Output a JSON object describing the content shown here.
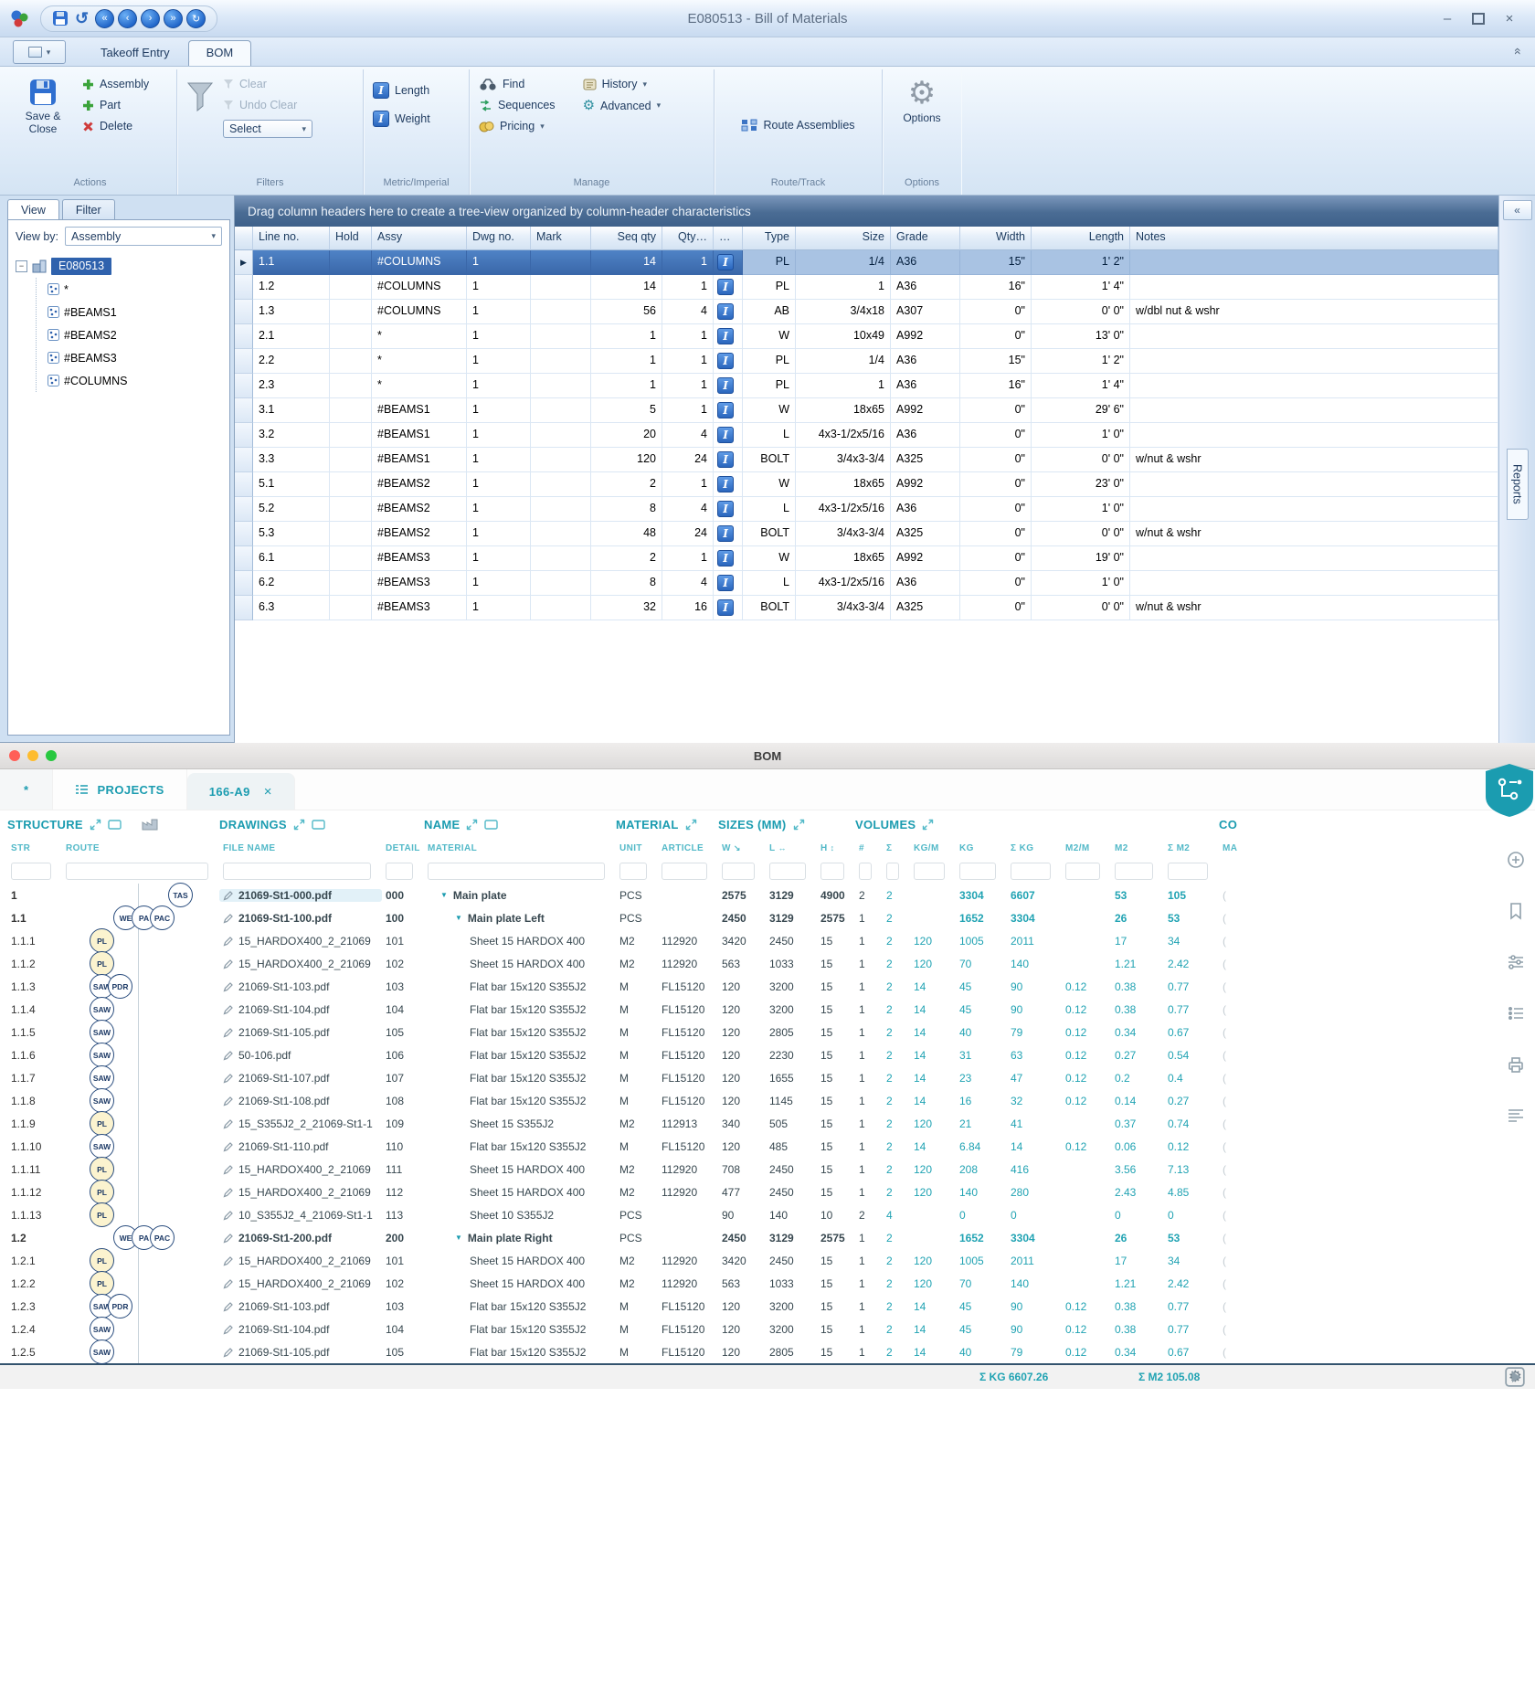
{
  "icons": {
    "dropdown": "▾",
    "collapse": "«",
    "close": "×",
    "minimize": "–",
    "undo": "↺",
    "gear": "⚙",
    "qat": [
      "«",
      "‹",
      "›",
      "»",
      "↻"
    ],
    "row_arrow": "▶",
    "tree_collapse": "−",
    "node_caret": "▼",
    "w_arrow": "↘",
    "l_arrow": "↔",
    "h_arrow": "↕"
  },
  "colors": {
    "accent_teal": "#1B9CB0",
    "selection_blue": "#3F71B8",
    "badge_yellow": "#FBF3CF",
    "traffic_red": "#FF5F57",
    "traffic_yellow": "#FEBC2E",
    "traffic_green": "#28C840"
  },
  "window": {
    "title": "E080513 - Bill of Materials",
    "app_tabs": {
      "takeoff": "Takeoff Entry",
      "bom": "BOM"
    },
    "ribbon": {
      "actions": {
        "label": "Actions",
        "save_close": "Save & Close",
        "assembly": "Assembly",
        "part": "Part",
        "delete": "Delete"
      },
      "filters": {
        "label": "Filters",
        "clear": "Clear",
        "undo_clear": "Undo Clear",
        "select": "Select"
      },
      "metric": {
        "label": "Metric/Imperial",
        "length": "Length",
        "weight": "Weight"
      },
      "manage": {
        "label": "Manage",
        "find": "Find",
        "sequences": "Sequences",
        "pricing": "Pricing",
        "history": "History",
        "advanced": "Advanced"
      },
      "route": {
        "label": "Route/Track",
        "route_assemblies": "Route Assemblies"
      },
      "options": {
        "label": "Options",
        "options": "Options"
      }
    },
    "left_panel": {
      "tabs": {
        "view": "View",
        "filter": "Filter"
      },
      "view_by_label": "View by:",
      "view_by_value": "Assembly",
      "tree": {
        "root": "E080513",
        "items": [
          "*",
          "#BEAMS1",
          "#BEAMS2",
          "#BEAMS3",
          "#COLUMNS"
        ]
      }
    },
    "grid": {
      "group_hint": "Drag column headers here to create a tree-view organized by column-header characteristics",
      "columns": [
        "Line no.",
        "Hold",
        "Assy",
        "Dwg no.",
        "Mark",
        "Seq qty",
        "Qty…",
        "…",
        "Type",
        "Size",
        "Grade",
        "Width",
        "Length",
        "Notes"
      ],
      "selected_index": 0,
      "rows": [
        [
          "1.1",
          "",
          "#COLUMNS",
          "1",
          "",
          "14",
          "1",
          "PL",
          "1/4",
          "A36",
          "15\"",
          "1' 2\"",
          ""
        ],
        [
          "1.2",
          "",
          "#COLUMNS",
          "1",
          "",
          "14",
          "1",
          "PL",
          "1",
          "A36",
          "16\"",
          "1' 4\"",
          ""
        ],
        [
          "1.3",
          "",
          "#COLUMNS",
          "1",
          "",
          "56",
          "4",
          "AB",
          "3/4x18",
          "A307",
          "0\"",
          "0' 0\"",
          "w/dbl nut & wshr"
        ],
        [
          "2.1",
          "",
          "*",
          "1",
          "",
          "1",
          "1",
          "W",
          "10x49",
          "A992",
          "0\"",
          "13' 0\"",
          ""
        ],
        [
          "2.2",
          "",
          "*",
          "1",
          "",
          "1",
          "1",
          "PL",
          "1/4",
          "A36",
          "15\"",
          "1' 2\"",
          ""
        ],
        [
          "2.3",
          "",
          "*",
          "1",
          "",
          "1",
          "1",
          "PL",
          "1",
          "A36",
          "16\"",
          "1' 4\"",
          ""
        ],
        [
          "3.1",
          "",
          "#BEAMS1",
          "1",
          "",
          "5",
          "1",
          "W",
          "18x65",
          "A992",
          "0\"",
          "29' 6\"",
          ""
        ],
        [
          "3.2",
          "",
          "#BEAMS1",
          "1",
          "",
          "20",
          "4",
          "L",
          "4x3-1/2x5/16",
          "A36",
          "0\"",
          "1' 0\"",
          ""
        ],
        [
          "3.3",
          "",
          "#BEAMS1",
          "1",
          "",
          "120",
          "24",
          "BOLT",
          "3/4x3-3/4",
          "A325",
          "0\"",
          "0' 0\"",
          "w/nut & wshr"
        ],
        [
          "5.1",
          "",
          "#BEAMS2",
          "1",
          "",
          "2",
          "1",
          "W",
          "18x65",
          "A992",
          "0\"",
          "23' 0\"",
          ""
        ],
        [
          "5.2",
          "",
          "#BEAMS2",
          "1",
          "",
          "8",
          "4",
          "L",
          "4x3-1/2x5/16",
          "A36",
          "0\"",
          "1' 0\"",
          ""
        ],
        [
          "5.3",
          "",
          "#BEAMS2",
          "1",
          "",
          "48",
          "24",
          "BOLT",
          "3/4x3-3/4",
          "A325",
          "0\"",
          "0' 0\"",
          "w/nut & wshr"
        ],
        [
          "6.1",
          "",
          "#BEAMS3",
          "1",
          "",
          "2",
          "1",
          "W",
          "18x65",
          "A992",
          "0\"",
          "19' 0\"",
          ""
        ],
        [
          "6.2",
          "",
          "#BEAMS3",
          "1",
          "",
          "8",
          "4",
          "L",
          "4x3-1/2x5/16",
          "A36",
          "0\"",
          "1' 0\"",
          ""
        ],
        [
          "6.3",
          "",
          "#BEAMS3",
          "1",
          "",
          "32",
          "16",
          "BOLT",
          "3/4x3-3/4",
          "A325",
          "0\"",
          "0' 0\"",
          "w/nut & wshr"
        ]
      ]
    },
    "reports_tab": "Reports"
  },
  "mac": {
    "title": "BOM",
    "tabs": {
      "star": "*",
      "projects": "PROJECTS",
      "active": "166-A9"
    },
    "table": {
      "groups": [
        "STRUCTURE",
        "DRAWINGS",
        "NAME",
        "MATERIAL",
        "SIZES (MM)",
        "VOLUMES",
        "CO"
      ],
      "subheaders": [
        "STR",
        "ROUTE",
        "FILE NAME",
        "DETAIL",
        "MATERIAL",
        "UNIT",
        "ARTICLE",
        "W",
        "L",
        "H",
        "#",
        "Σ",
        "KG/M",
        "KG",
        "Σ KG",
        "M2/M",
        "M2",
        "Σ M2",
        "MA"
      ],
      "row_fields": [
        "str",
        "badges",
        "badge_pos",
        "file",
        "detail",
        "indent",
        "name",
        "unit",
        "article",
        "w",
        "l",
        "h",
        "n",
        "sum",
        "kgm",
        "kg",
        "skg",
        "m2m",
        "m2",
        "sm2",
        "parent"
      ],
      "rows": [
        [
          "1",
          [
            "TAS"
          ],
          "r",
          "21069-St1-000.pdf",
          "000",
          0,
          "Main plate",
          "PCS",
          "",
          "2575",
          "3129",
          "4900",
          "2",
          "2",
          "",
          "3304",
          "6607",
          "",
          "53",
          "105",
          true
        ],
        [
          "1.1",
          [
            "WE",
            "PA",
            "PAC"
          ],
          "m",
          "21069-St1-100.pdf",
          "100",
          1,
          "Main plate Left",
          "PCS",
          "",
          "2450",
          "3129",
          "2575",
          "1",
          "2",
          "",
          "1652",
          "3304",
          "",
          "26",
          "53",
          true
        ],
        [
          "1.1.1",
          [
            "PL"
          ],
          "l",
          "15_HARDOX400_2_21069",
          "101",
          2,
          "Sheet 15 HARDOX 400",
          "M2",
          "112920",
          "3420",
          "2450",
          "15",
          "1",
          "2",
          "120",
          "1005",
          "2011",
          "",
          "17",
          "34",
          false
        ],
        [
          "1.1.2",
          [
            "PL"
          ],
          "l",
          "15_HARDOX400_2_21069",
          "102",
          2,
          "Sheet 15 HARDOX 400",
          "M2",
          "112920",
          "563",
          "1033",
          "15",
          "1",
          "2",
          "120",
          "70",
          "140",
          "",
          "1.21",
          "2.42",
          false
        ],
        [
          "1.1.3",
          [
            "SAW",
            "PDR"
          ],
          "l",
          "21069-St1-103.pdf",
          "103",
          2,
          "Flat bar 15x120 S355J2",
          "M",
          "FL15120",
          "120",
          "3200",
          "15",
          "1",
          "2",
          "14",
          "45",
          "90",
          "0.12",
          "0.38",
          "0.77",
          false
        ],
        [
          "1.1.4",
          [
            "SAW"
          ],
          "l",
          "21069-St1-104.pdf",
          "104",
          2,
          "Flat bar 15x120 S355J2",
          "M",
          "FL15120",
          "120",
          "3200",
          "15",
          "1",
          "2",
          "14",
          "45",
          "90",
          "0.12",
          "0.38",
          "0.77",
          false
        ],
        [
          "1.1.5",
          [
            "SAW"
          ],
          "l",
          "21069-St1-105.pdf",
          "105",
          2,
          "Flat bar 15x120 S355J2",
          "M",
          "FL15120",
          "120",
          "2805",
          "15",
          "1",
          "2",
          "14",
          "40",
          "79",
          "0.12",
          "0.34",
          "0.67",
          false
        ],
        [
          "1.1.6",
          [
            "SAW"
          ],
          "l",
          "50-106.pdf",
          "106",
          2,
          "Flat bar 15x120 S355J2",
          "M",
          "FL15120",
          "120",
          "2230",
          "15",
          "1",
          "2",
          "14",
          "31",
          "63",
          "0.12",
          "0.27",
          "0.54",
          false
        ],
        [
          "1.1.7",
          [
            "SAW"
          ],
          "l",
          "21069-St1-107.pdf",
          "107",
          2,
          "Flat bar 15x120 S355J2",
          "M",
          "FL15120",
          "120",
          "1655",
          "15",
          "1",
          "2",
          "14",
          "23",
          "47",
          "0.12",
          "0.2",
          "0.4",
          false
        ],
        [
          "1.1.8",
          [
            "SAW"
          ],
          "l",
          "21069-St1-108.pdf",
          "108",
          2,
          "Flat bar 15x120 S355J2",
          "M",
          "FL15120",
          "120",
          "1145",
          "15",
          "1",
          "2",
          "14",
          "16",
          "32",
          "0.12",
          "0.14",
          "0.27",
          false
        ],
        [
          "1.1.9",
          [
            "PL"
          ],
          "l",
          "15_S355J2_2_21069-St1-1",
          "109",
          2,
          "Sheet 15 S355J2",
          "M2",
          "112913",
          "340",
          "505",
          "15",
          "1",
          "2",
          "120",
          "21",
          "41",
          "",
          "0.37",
          "0.74",
          false
        ],
        [
          "1.1.10",
          [
            "SAW"
          ],
          "l",
          "21069-St1-110.pdf",
          "110",
          2,
          "Flat bar 15x120 S355J2",
          "M",
          "FL15120",
          "120",
          "485",
          "15",
          "1",
          "2",
          "14",
          "6.84",
          "14",
          "0.12",
          "0.06",
          "0.12",
          false
        ],
        [
          "1.1.11",
          [
            "PL"
          ],
          "l",
          "15_HARDOX400_2_21069",
          "111",
          2,
          "Sheet 15 HARDOX 400",
          "M2",
          "112920",
          "708",
          "2450",
          "15",
          "1",
          "2",
          "120",
          "208",
          "416",
          "",
          "3.56",
          "7.13",
          false
        ],
        [
          "1.1.12",
          [
            "PL"
          ],
          "l",
          "15_HARDOX400_2_21069",
          "112",
          2,
          "Sheet 15 HARDOX 400",
          "M2",
          "112920",
          "477",
          "2450",
          "15",
          "1",
          "2",
          "120",
          "140",
          "280",
          "",
          "2.43",
          "4.85",
          false
        ],
        [
          "1.1.13",
          [
            "PL"
          ],
          "l",
          "10_S355J2_4_21069-St1-1",
          "113",
          2,
          "Sheet 10 S355J2",
          "PCS",
          "",
          "90",
          "140",
          "10",
          "2",
          "4",
          "",
          "0",
          "0",
          "",
          "0",
          "0",
          false
        ],
        [
          "1.2",
          [
            "WE",
            "PA",
            "PAC"
          ],
          "m",
          "21069-St1-200.pdf",
          "200",
          1,
          "Main plate Right",
          "PCS",
          "",
          "2450",
          "3129",
          "2575",
          "1",
          "2",
          "",
          "1652",
          "3304",
          "",
          "26",
          "53",
          true
        ],
        [
          "1.2.1",
          [
            "PL"
          ],
          "l",
          "15_HARDOX400_2_21069",
          "101",
          2,
          "Sheet 15 HARDOX 400",
          "M2",
          "112920",
          "3420",
          "2450",
          "15",
          "1",
          "2",
          "120",
          "1005",
          "2011",
          "",
          "17",
          "34",
          false
        ],
        [
          "1.2.2",
          [
            "PL"
          ],
          "l",
          "15_HARDOX400_2_21069",
          "102",
          2,
          "Sheet 15 HARDOX 400",
          "M2",
          "112920",
          "563",
          "1033",
          "15",
          "1",
          "2",
          "120",
          "70",
          "140",
          "",
          "1.21",
          "2.42",
          false
        ],
        [
          "1.2.3",
          [
            "SAW",
            "PDR"
          ],
          "l",
          "21069-St1-103.pdf",
          "103",
          2,
          "Flat bar 15x120 S355J2",
          "M",
          "FL15120",
          "120",
          "3200",
          "15",
          "1",
          "2",
          "14",
          "45",
          "90",
          "0.12",
          "0.38",
          "0.77",
          false
        ],
        [
          "1.2.4",
          [
            "SAW"
          ],
          "l",
          "21069-St1-104.pdf",
          "104",
          2,
          "Flat bar 15x120 S355J2",
          "M",
          "FL15120",
          "120",
          "3200",
          "15",
          "1",
          "2",
          "14",
          "45",
          "90",
          "0.12",
          "0.38",
          "0.77",
          false
        ],
        [
          "1.2.5",
          [
            "SAW"
          ],
          "l",
          "21069-St1-105.pdf",
          "105",
          2,
          "Flat bar 15x120 S355J2",
          "M",
          "FL15120",
          "120",
          "2805",
          "15",
          "1",
          "2",
          "14",
          "40",
          "79",
          "0.12",
          "0.34",
          "0.67",
          false
        ]
      ]
    },
    "footer": {
      "sum_kg": "Σ KG 6607.26",
      "sum_m2": "Σ M2 105.08"
    }
  }
}
